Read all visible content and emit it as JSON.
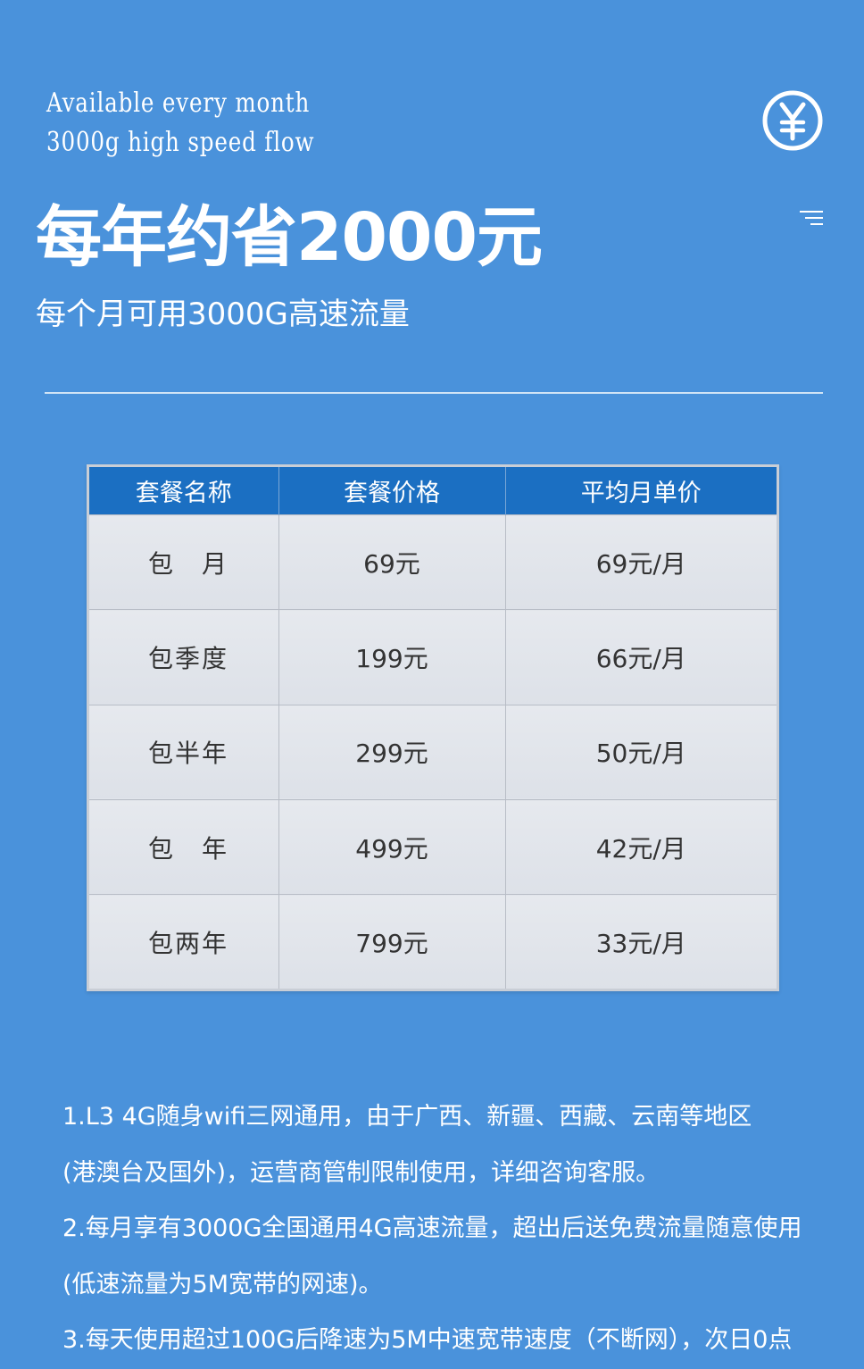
{
  "header": {
    "tagline_line1": "Available every month",
    "tagline_line2": "3000g high speed flow",
    "headline": "每年约省2000元",
    "subhead": "每个月可用3000G高速流量",
    "yen_icon": "yen-circle-icon",
    "menu_icon": "menu-icon"
  },
  "table": {
    "headers": [
      "套餐名称",
      "套餐价格",
      "平均月单价"
    ],
    "rows": [
      {
        "name": "包　月",
        "price": "69元",
        "monthly": "69元/月"
      },
      {
        "name": "包季度",
        "price": "199元",
        "monthly": "66元/月"
      },
      {
        "name": "包半年",
        "price": "299元",
        "monthly": "50元/月"
      },
      {
        "name": "包　年",
        "price": "499元",
        "monthly": "42元/月"
      },
      {
        "name": "包两年",
        "price": "799元",
        "monthly": "33元/月"
      }
    ]
  },
  "notes": [
    "1.L3 4G随身wifi三网通用，由于广西、新疆、西藏、云南等地区",
    "(港澳台及国外)，运营商管制限制使用，详细咨询客服。",
    "2.每月享有3000G全国通用4G高速流量，超出后送免费流量随意使用",
    "(低速流量为5M宽带的网速)。",
    "3.每天使用超过100G后降速为5M中速宽带速度（不断网），次日0点"
  ],
  "colors": {
    "background": "#4a92db",
    "table_header": "#1b6fc2",
    "table_body": "#dfe3ea"
  }
}
